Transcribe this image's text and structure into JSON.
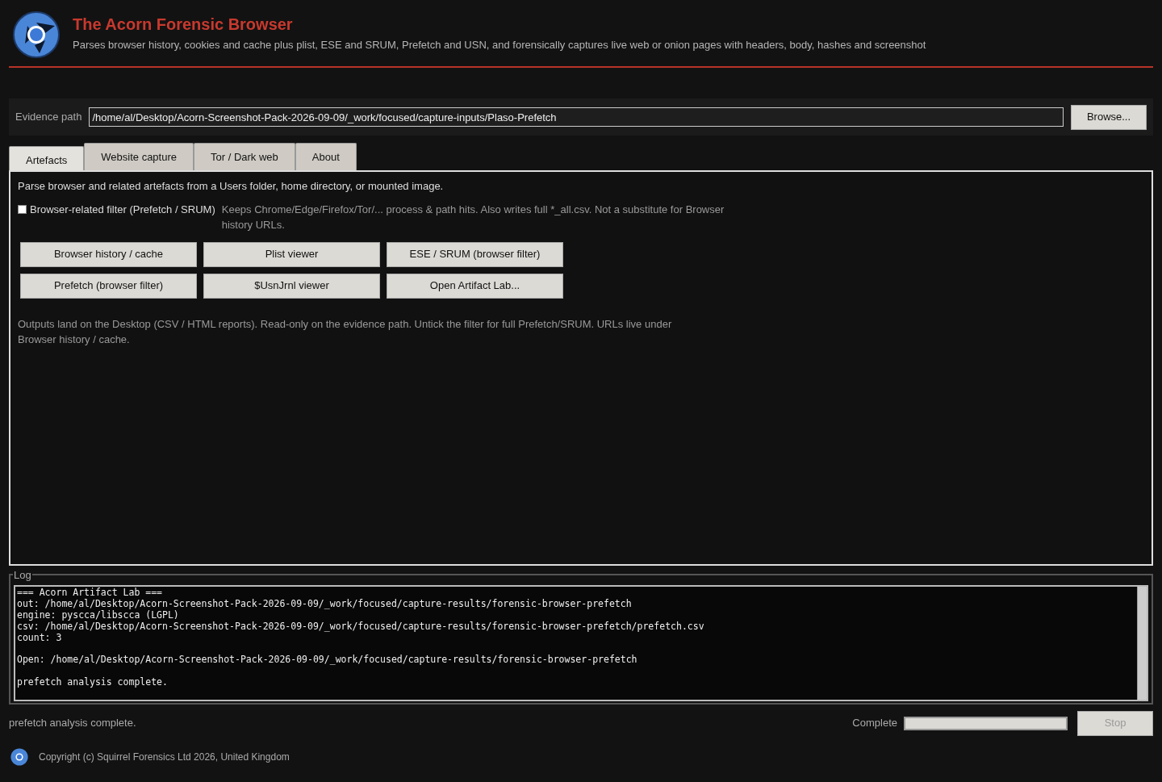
{
  "header": {
    "title": "The Acorn Forensic Browser",
    "subtitle": "Parses browser history, cookies and cache plus plist, ESE and SRUM, Prefetch and USN, and forensically captures live web or onion pages with headers, body, hashes and screenshot"
  },
  "evidence": {
    "label": "Evidence path",
    "value": "/home/al/Desktop/Acorn-Screenshot-Pack-2026-09-09/_work/focused/capture-inputs/Plaso-Prefetch",
    "button": "Browse..."
  },
  "tabs": [
    {
      "label": "Artefacts",
      "selected": true
    },
    {
      "label": "Website capture",
      "selected": false
    },
    {
      "label": "Tor / Dark web",
      "selected": false
    },
    {
      "label": "About",
      "selected": false
    }
  ],
  "panel": {
    "intro": "Parse browser and related artefacts from a Users folder, home directory, or mounted image.",
    "filter": {
      "label": "Browser-related filter (Prefetch / SRUM)",
      "checked": false,
      "hint": "Keeps Chrome/Edge/Firefox/Tor/... process & path hits. Also writes full *_all.csv. Not a substitute for Browser history URLs."
    },
    "buttons": [
      "Browser history / cache",
      "Plist viewer",
      "ESE / SRUM (browser filter)",
      "Prefetch (browser filter)",
      "$UsnJrnl viewer",
      "Open Artifact Lab..."
    ],
    "note": "Outputs land on the Desktop (CSV / HTML reports). Read-only on the evidence path. Untick the filter for full Prefetch/SRUM. URLs live under Browser history / cache."
  },
  "log": {
    "title": "Log",
    "blocks": [
      [
        "=== Acorn Artifact Lab ===",
        "out: /home/al/Desktop/Acorn-Screenshot-Pack-2026-09-09/_work/focused/capture-results/forensic-browser-prefetch",
        "engine: pyscca/libscca (LGPL)",
        "csv: /home/al/Desktop/Acorn-Screenshot-Pack-2026-09-09/_work/focused/capture-results/forensic-browser-prefetch/prefetch.csv",
        "count: 3"
      ],
      [
        "Open: /home/al/Desktop/Acorn-Screenshot-Pack-2026-09-09/_work/focused/capture-results/forensic-browser-prefetch"
      ],
      [
        "prefetch analysis complete."
      ]
    ]
  },
  "status_bar": {
    "message": "prefetch analysis complete.",
    "progress_label": "Complete",
    "level": 1,
    "stop": {
      "label": "Stop",
      "disabled": true
    }
  },
  "footer": {
    "copyright": "Copyright (c) Squirrel Forensics Ltd 2026, United Kingdom"
  }
}
